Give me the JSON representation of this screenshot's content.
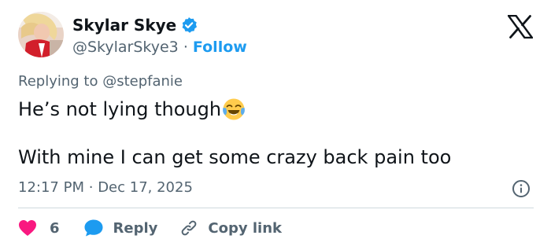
{
  "author": {
    "display_name": "Skylar Skye",
    "handle": "@SkylarSkye3",
    "separator": "·",
    "follow_label": "Follow",
    "verified_color": "#1d9bf0"
  },
  "reply": {
    "prefix": "Replying to",
    "target": "@stepfanie"
  },
  "tweet": {
    "line1": "He’s not lying though",
    "line2": "With mine I can get some crazy back pain too",
    "emoji": "face-with-tears-of-joy"
  },
  "meta": {
    "time": "12:17 PM",
    "separator": "·",
    "date": "Dec 17, 2025"
  },
  "actions": {
    "like_count": "6",
    "reply_label": "Reply",
    "copy_label": "Copy link"
  },
  "colors": {
    "text": "#0f1419",
    "secondary": "#536471",
    "accent": "#1d9bf0",
    "like": "#f91880",
    "divider": "#cfd9de"
  }
}
